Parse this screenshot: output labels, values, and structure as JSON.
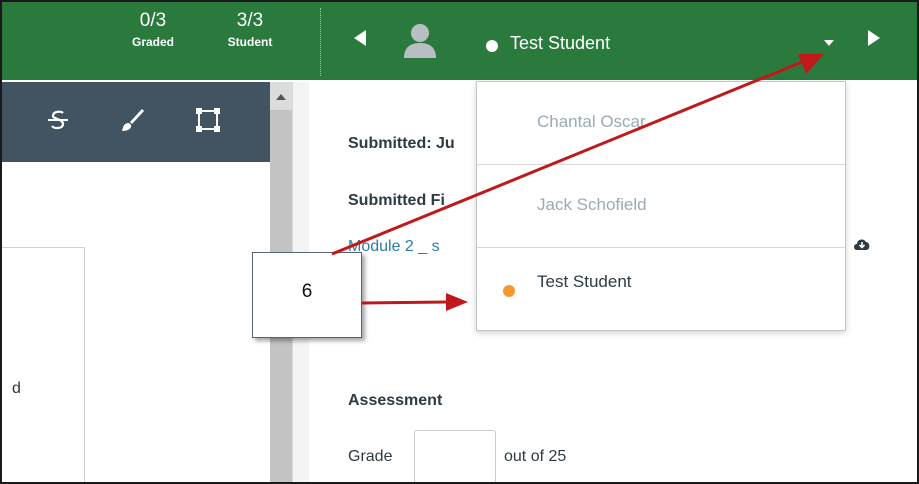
{
  "header": {
    "graded_count": "0/3",
    "graded_label": "Graded",
    "student_count": "3/3",
    "student_label": "Student",
    "current_student": "Test Student"
  },
  "submission": {
    "submitted_label": "Submitted: Ju",
    "submitted_files_label": "Submitted Fi",
    "file_link": "Module 2 _ s"
  },
  "document": {
    "fragment": "d"
  },
  "dropdown": {
    "items": [
      {
        "label": "Chantal Oscar",
        "status": "muted"
      },
      {
        "label": "Jack Schofield",
        "status": "muted"
      },
      {
        "label": "Test Student",
        "status": "current"
      }
    ]
  },
  "assessment": {
    "heading": "Assessment",
    "grade_label": "Grade",
    "grade_value": "",
    "out_of": "out of 25"
  },
  "annotation": {
    "callout_number": "6",
    "arrow_color": "#c0181b"
  },
  "colors": {
    "header_green": "#2a7a3e",
    "toolbar_slate": "#425461",
    "orange_dot": "#f29a2e"
  },
  "icons": [
    "strikethrough-icon",
    "brush-icon",
    "crop-select-icon",
    "user-avatar-icon",
    "cloud-download-icon"
  ]
}
